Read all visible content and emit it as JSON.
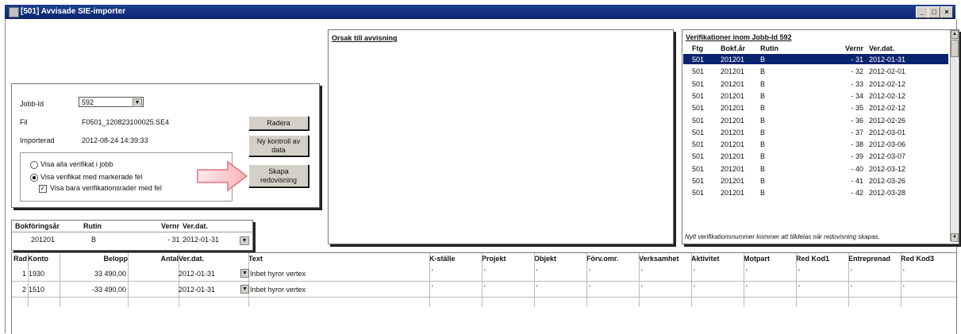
{
  "window": {
    "title": "[501] Avvisade SIE-importer",
    "minimize": "_",
    "maximize": "□",
    "close": "×"
  },
  "job": {
    "jobb_label": "Jobb-Id",
    "jobb_value": "592",
    "fil_label": "Fil",
    "fil_value": "F0501_120823100025.SE4",
    "imp_label": "Importerad",
    "imp_value": "2012-08-24 14:39:33",
    "opt_all": "Visa alla verifikat i jobb",
    "opt_marked": "Visa verifikat med markerade fel",
    "opt_rows": "Visa bara verifikationsrader med fel",
    "btn_radera": "Radera",
    "btn_ny": "Ny kontroll av data",
    "btn_skapa": "Skapa redovisning"
  },
  "orsak": {
    "title": "Orsak till avvisning"
  },
  "verlist": {
    "title": "Verifikationer inom Jobb-Id 592",
    "headers": [
      "Ftg",
      "Bokf.år",
      "Rutin",
      "Vernr",
      "Ver.dat."
    ],
    "rows": [
      [
        "501",
        "201201",
        "B",
        "- 31",
        "2012-01-31"
      ],
      [
        "501",
        "201201",
        "B",
        "- 32",
        "2012-02-01"
      ],
      [
        "501",
        "201201",
        "B",
        "- 33",
        "2012-02-12"
      ],
      [
        "501",
        "201201",
        "B",
        "- 34",
        "2012-02-12"
      ],
      [
        "501",
        "201201",
        "B",
        "- 35",
        "2012-02-12"
      ],
      [
        "501",
        "201201",
        "B",
        "- 36",
        "2012-02-26"
      ],
      [
        "501",
        "201201",
        "B",
        "- 37",
        "2012-03-01"
      ],
      [
        "501",
        "201201",
        "B",
        "- 38",
        "2012-03-06"
      ],
      [
        "501",
        "201201",
        "B",
        "- 39",
        "2012-03-07"
      ],
      [
        "501",
        "201201",
        "B",
        "- 40",
        "2012-03-12"
      ],
      [
        "501",
        "201201",
        "B",
        "- 41",
        "2012-03-26"
      ],
      [
        "501",
        "201201",
        "B",
        "- 42",
        "2012-03-28"
      ]
    ],
    "footer": "Nytt verifikationsnummer kommer att tilldelas när redovisning skapas."
  },
  "header": {
    "bokf_label": "Bokföringsår",
    "rutin_label": "Rutin",
    "vernr_label": "Vernr",
    "verdat_label": "Ver.dat.",
    "bokf_value": "201201",
    "rutin_value": "B",
    "vernr_value": "- 31",
    "verdat_value": "2012-01-31"
  },
  "rows_table": {
    "headers": [
      "Rad",
      "Konto",
      "Belopp",
      "Antal",
      "Ver.dat.",
      "Text",
      "K-ställe",
      "Projekt",
      "Objekt",
      "Förv.omr.",
      "Verksamhet",
      "Aktivitet",
      "Motpart",
      "Red Kod1",
      "Entreprenad",
      "Red Kod3"
    ],
    "rows": [
      {
        "rad": "1",
        "konto": "1930",
        "belopp": "33 490,00",
        "antal": "",
        "verdat": "2012-01-31",
        "text": "Inbet hyror vertex",
        "dim": [
          "'",
          "'",
          "'",
          "'",
          "'",
          "'",
          "'",
          "'",
          "'",
          "'"
        ]
      },
      {
        "rad": "2",
        "konto": "1510",
        "belopp": "-33 490,00",
        "antal": "",
        "verdat": "2012-01-31",
        "text": "Inbet hyror vertex",
        "dim": [
          "'",
          "'",
          "'",
          "'",
          "'",
          "'",
          "'",
          "'",
          "'",
          "'"
        ]
      }
    ]
  }
}
